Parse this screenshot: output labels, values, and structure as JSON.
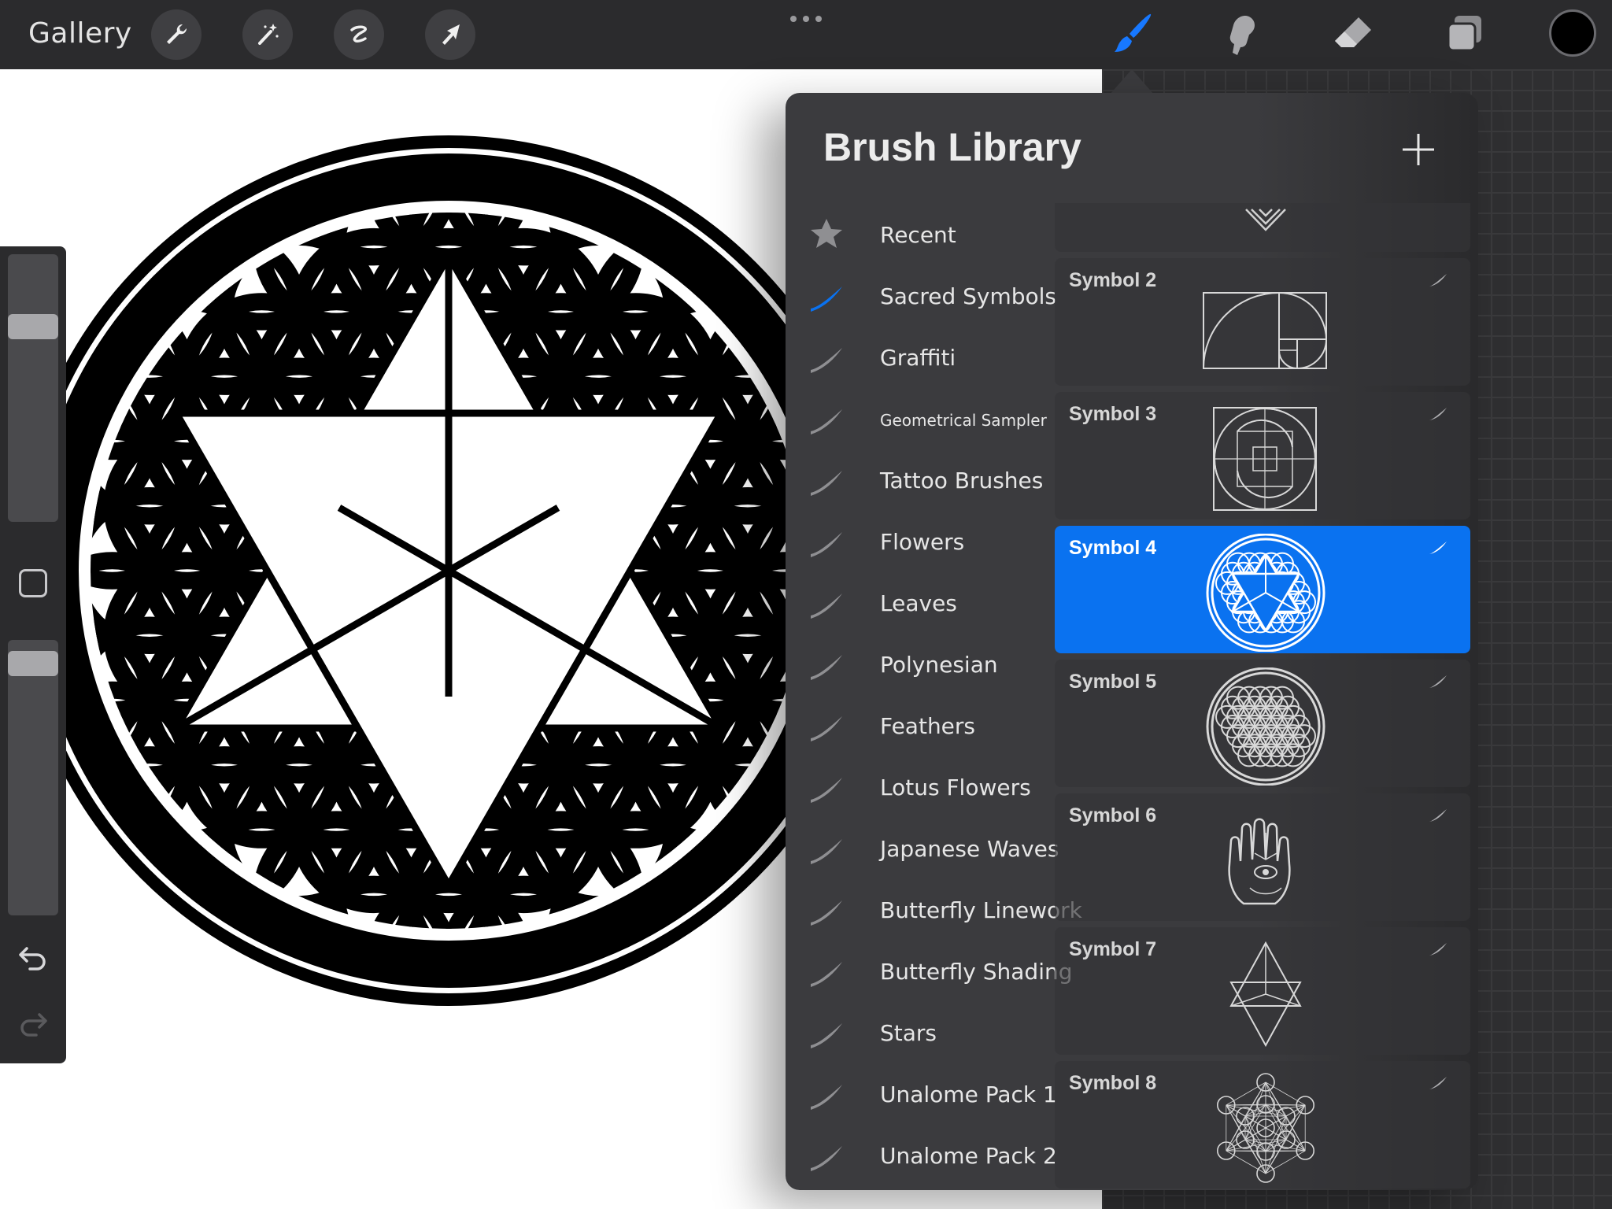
{
  "topbar": {
    "gallery_label": "Gallery",
    "left_tools": [
      "wrench-icon",
      "magic-wand-icon",
      "selection-icon",
      "transform-arrow-icon"
    ],
    "right_tools": [
      "paintbrush-icon",
      "smudge-icon",
      "eraser-icon",
      "layers-icon"
    ],
    "active_tool": "paintbrush-icon",
    "current_color": "#000000"
  },
  "colors": {
    "accent": "#0a72f0",
    "panel": "#3b3b3e",
    "bar": "#2b2b2d"
  },
  "brush_library": {
    "title": "Brush Library",
    "categories": [
      {
        "label": "Recent",
        "icon": "star-icon"
      },
      {
        "label": "Sacred Symbols",
        "icon": "brush-stroke-icon",
        "selected": true
      },
      {
        "label": "Graffiti",
        "icon": "brush-stroke-icon"
      },
      {
        "label": "Geometrical Sampler",
        "icon": "brush-stroke-icon"
      },
      {
        "label": "Tattoo Brushes",
        "icon": "brush-stroke-icon"
      },
      {
        "label": "Flowers",
        "icon": "brush-stroke-icon"
      },
      {
        "label": "Leaves",
        "icon": "brush-stroke-icon"
      },
      {
        "label": "Polynesian",
        "icon": "brush-stroke-icon"
      },
      {
        "label": "Feathers",
        "icon": "brush-stroke-icon"
      },
      {
        "label": "Lotus Flowers",
        "icon": "brush-stroke-icon"
      },
      {
        "label": "Japanese Waves",
        "icon": "brush-stroke-icon"
      },
      {
        "label": "Butterfly Linework",
        "icon": "brush-stroke-icon"
      },
      {
        "label": "Butterfly Shading",
        "icon": "brush-stroke-icon"
      },
      {
        "label": "Stars",
        "icon": "brush-stroke-icon"
      },
      {
        "label": "Unalome Pack 1",
        "icon": "brush-stroke-icon"
      },
      {
        "label": "Unalome Pack 2",
        "icon": "brush-stroke-icon"
      }
    ],
    "brushes": [
      {
        "name": "Symbol 2",
        "thumb": "golden-spiral"
      },
      {
        "name": "Symbol 3",
        "thumb": "quad-spiral"
      },
      {
        "name": "Symbol 4",
        "thumb": "flower-star",
        "selected": true
      },
      {
        "name": "Symbol 5",
        "thumb": "flower-of-life"
      },
      {
        "name": "Symbol 6",
        "thumb": "hamsa"
      },
      {
        "name": "Symbol 7",
        "thumb": "merkaba"
      },
      {
        "name": "Symbol 8",
        "thumb": "metatron-cube"
      }
    ]
  }
}
